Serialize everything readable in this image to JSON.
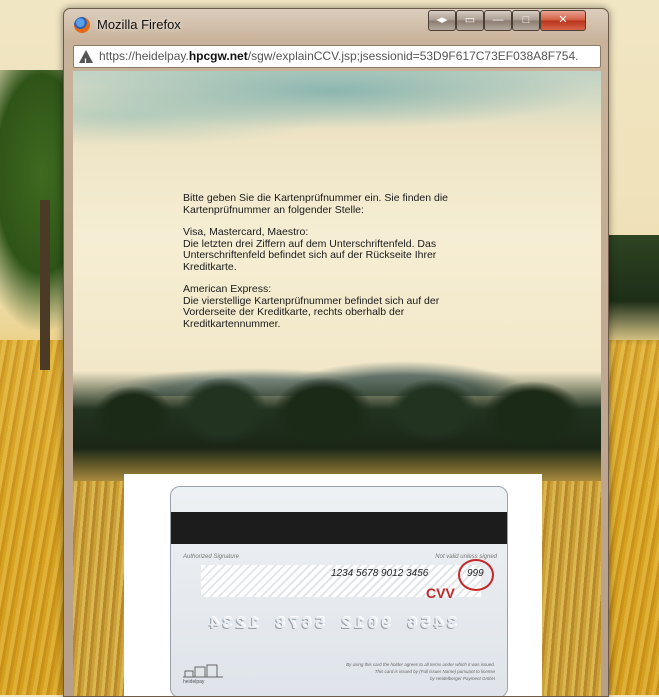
{
  "window": {
    "title": "Mozilla Firefox",
    "url_prefix": "https://heidelpay.",
    "url_domain": "hpcgw.net",
    "url_path": "/sgw/explainCCV.jsp;jsessionid=53D9F617C73EF038A8F754."
  },
  "instructions": {
    "intro": "Bitte geben Sie die Kartenprüfnummer ein. Sie finden die Kartenprüfnummer an folgender Stelle:",
    "visa_heading": "Visa, Mastercard, Maestro:",
    "visa_text": "Die letzten drei Ziffern auf dem Unterschriftenfeld. Das Unterschriftenfeld befindet sich auf der Rückseite Ihrer Kreditkarte.",
    "amex_heading": "American Express:",
    "amex_text": "Die vierstellige Kartenprüfnummer befindet sich auf der Vorderseite der Kreditkarte, rechts oberhalb der Kreditkartennummer."
  },
  "card": {
    "authorized_signature": "Authorized Signature",
    "not_valid_unless_signed": "Not valid unless signed",
    "number": "1234 5678 9012 3456",
    "cvv_code": "999",
    "cvv_label": "CVV",
    "embossed_mirrored": "3456 9012 5678 1234",
    "fine_print_1": "By using this card the holder agrees to all terms under which it was issued.",
    "fine_print_2": "This card is issued by (Full issuer Name) pursuant to license",
    "fine_print_3": "by Heidelberger Payment GmbH",
    "logo_text": "heidelpay"
  },
  "colors": {
    "cvv_accent": "#c62828",
    "magstripe": "#1c1c1c"
  }
}
